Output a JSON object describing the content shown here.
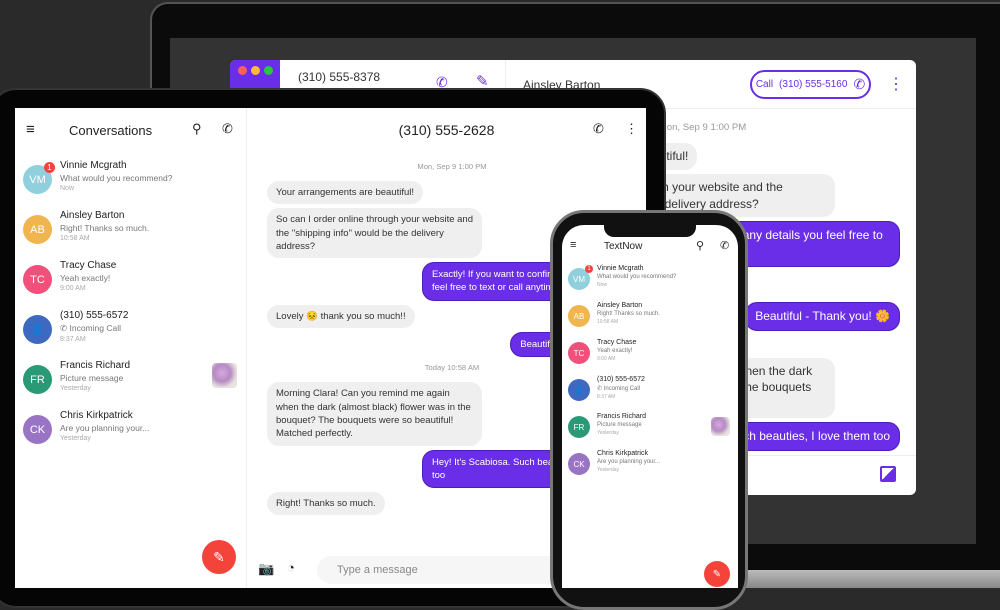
{
  "colors": {
    "accent": "#6a2ee8",
    "fab": "#f4433a",
    "badge": "#f4433a"
  },
  "laptop": {
    "sidebar_number": "(310) 555-8378",
    "contact": "Ainsley Barton",
    "call_label": "Call",
    "call_number": "(310) 555-5160"
  },
  "tablet": {
    "title": "Conversations",
    "chat_title": "(310) 555-2628",
    "input_placeholder": "Type a message"
  },
  "phone": {
    "title": "TextNow"
  },
  "conversations": [
    {
      "initials": "VM",
      "name": "Vinnie Mcgrath",
      "preview": "What would you recommend?",
      "time": "Now",
      "color": "#8fd0dc",
      "badge": "1"
    },
    {
      "initials": "AB",
      "name": "Ainsley Barton",
      "preview": "Right! Thanks so much.",
      "time": "10:58 AM",
      "color": "#f0b54f"
    },
    {
      "initials": "TC",
      "name": "Tracy Chase",
      "preview": "Yeah exactly!",
      "time": "9:00 AM",
      "color": "#f0507a"
    },
    {
      "initials": "",
      "name": "(310) 555-6572",
      "preview": "Incoming Call",
      "time": "8:37 AM",
      "color": "#3d6ac0",
      "icon": "person-icon"
    },
    {
      "initials": "FR",
      "name": "Francis Richard",
      "preview": "Picture message",
      "time": "Yesterday",
      "color": "#2a9a76",
      "thumb": true
    },
    {
      "initials": "CK",
      "name": "Chris Kirkpatrick",
      "preview": "Are you planning your...",
      "time": "Yesterday",
      "color": "#9a74c4"
    }
  ],
  "messages": [
    {
      "type": "date",
      "text": "Mon, Sep 9 1:00 PM"
    },
    {
      "type": "in",
      "text": "Your arrangements are beautiful!"
    },
    {
      "type": "in",
      "text": "So can I order online through your website and the \"shipping info\" would be the delivery address?"
    },
    {
      "type": "out",
      "text": "Exactly! If you want to confirm any details you feel free to text or call anytime."
    },
    {
      "type": "in",
      "text": "Lovely 😣 thank you so much!!"
    },
    {
      "type": "out",
      "text": "Beautiful - Thank you! 🌼"
    },
    {
      "type": "date",
      "text": "Today 10:58 AM"
    },
    {
      "type": "in",
      "text": "Morning Clara! Can you remind me again when the dark (almost black) flower was in the bouquet? The bouquets were so beautiful! Matched perfectly."
    },
    {
      "type": "out",
      "text": "Hey! It's Scabiosa. Such beauties, I love them too"
    },
    {
      "type": "in",
      "text": "Right! Thanks so much."
    }
  ]
}
